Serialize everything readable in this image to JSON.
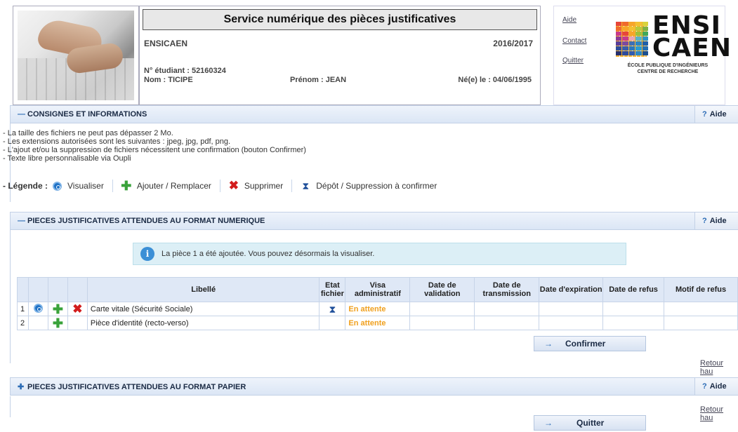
{
  "header": {
    "title": "Service numérique des pièces justificatives",
    "school": "ENSICAEN",
    "year": "2016/2017",
    "student_number": "N° étudiant : 52160324",
    "last_name": "Nom : TICIPE",
    "first_name": "Prénom : JEAN",
    "birth_date": "Né(e) le : 04/06/1995"
  },
  "top_links": [
    "Aide",
    "Contact",
    "Quitter"
  ],
  "logo": {
    "line1": "ENSI",
    "line2": "CAEN",
    "sub1": "ÉCOLE PUBLIQUE D'INGÉNIEURS",
    "sub2": "CENTRE DE RECHERCHE"
  },
  "sections": {
    "consignes": {
      "title": "CONSIGNES ET INFORMATIONS",
      "help": "Aide"
    },
    "numerique": {
      "title": "PIECES JUSTIFICATIVES ATTENDUES AU FORMAT NUMERIQUE",
      "help": "Aide"
    },
    "papier": {
      "title": "PIECES JUSTIFICATIVES ATTENDUES AU FORMAT PAPIER",
      "help": "Aide"
    }
  },
  "consignes": [
    "- La taille des fichiers ne peut pas dépasser 2 Mo.",
    "- Les extensions autorisées sont les suivantes : jpeg, jpg, pdf, png.",
    "- L'ajout et/ou la suppression de fichiers nécessitent une confirmation (bouton Confirmer)",
    "- Texte libre personnalisable via Oupli"
  ],
  "legend": {
    "label": "- Légende :",
    "view": "Visualiser",
    "add": "Ajouter / Remplacer",
    "delete": "Supprimer",
    "pending": "Dépôt / Suppression à confirmer"
  },
  "info_message": "La pièce 1 a été ajoutée. Vous pouvez désormais la visualiser.",
  "table": {
    "headers": {
      "libelle": "Libellé",
      "etat": "Etat fichier",
      "visa": "Visa administratif",
      "validation": "Date de validation",
      "transmission": "Date de transmission",
      "expiration": "Date d'expiration",
      "refus": "Date de refus",
      "motif": "Motif de refus"
    },
    "rows": [
      {
        "num": "1",
        "libelle": "Carte vitale (Sécurité Sociale)",
        "visa": "En attente"
      },
      {
        "num": "2",
        "libelle": "Pièce d'identité (recto-verso)",
        "visa": "En attente"
      }
    ]
  },
  "buttons": {
    "confirm": "Confirmer",
    "quit": "Quitter"
  },
  "retour": "Retour hau"
}
